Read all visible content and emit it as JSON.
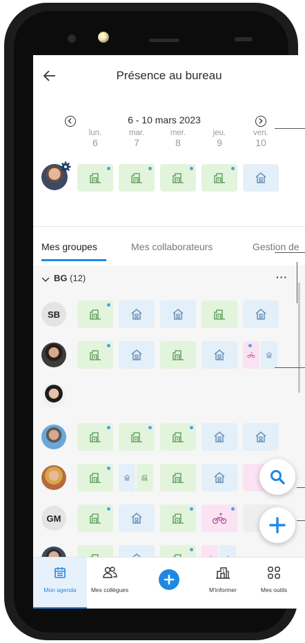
{
  "header": {
    "title": "Présence au bureau"
  },
  "week": {
    "label": "6 - 10 mars 2023"
  },
  "days": [
    {
      "name": "lun.",
      "num": "6"
    },
    {
      "name": "mar.",
      "num": "7"
    },
    {
      "name": "mer.",
      "num": "8"
    },
    {
      "name": "jeu.",
      "num": "9"
    },
    {
      "name": "ven.",
      "num": "10"
    }
  ],
  "tabs": [
    "Mes groupes",
    "Mes collaborateurs",
    "Gestion de"
  ],
  "group": {
    "name": "BG",
    "count": "(12)",
    "menu": "···"
  },
  "people": {
    "p1": {
      "initials": "SB"
    },
    "p6": {
      "initials": "GM"
    }
  },
  "nav": {
    "agenda": "Mon agenda",
    "colleagues": "Mes collègues",
    "inform": "M'informer",
    "tools": "Mes outils"
  },
  "colors": {
    "accent": "#1e88e5",
    "office": "#e3f4dd",
    "home": "#e3eff9",
    "bike": "#fbe3f3"
  },
  "icons": [
    "arrow-left-icon",
    "chevron-left-icon",
    "chevron-right-icon",
    "gear-icon",
    "office-icon",
    "home-icon",
    "bike-icon",
    "search-icon",
    "plus-icon",
    "calendar-icon",
    "people-icon",
    "building-icon",
    "grid-icon"
  ]
}
